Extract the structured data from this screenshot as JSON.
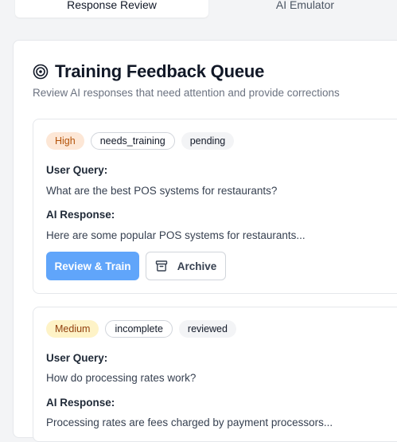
{
  "tabs": [
    {
      "label": "Response Review"
    },
    {
      "label": "AI Emulator"
    }
  ],
  "panel": {
    "title": "Training Feedback Queue",
    "subtitle": "Review AI responses that need attention and provide corrections"
  },
  "cards": [
    {
      "priority": "High",
      "tags": [
        "needs_training",
        "pending"
      ],
      "query_label": "User Query:",
      "query": "What are the best POS systems for restaurants?",
      "response_label": "AI Response:",
      "response": "Here are some popular POS systems for restaurants...",
      "review_button": "Review & Train",
      "archive_button": "Archive"
    },
    {
      "priority": "Medium",
      "tags": [
        "incomplete",
        "reviewed"
      ],
      "query_label": "User Query:",
      "query": "How do processing rates work?",
      "response_label": "AI Response:",
      "response": "Processing rates are fees charged by payment processors..."
    }
  ],
  "icons": {
    "title_icon": "target-icon",
    "archive_icon": "archive-icon"
  },
  "colors": {
    "primary_button": "#60a5fa",
    "high_badge_bg": "#fde7d6",
    "medium_badge_bg": "#fef3c7"
  }
}
